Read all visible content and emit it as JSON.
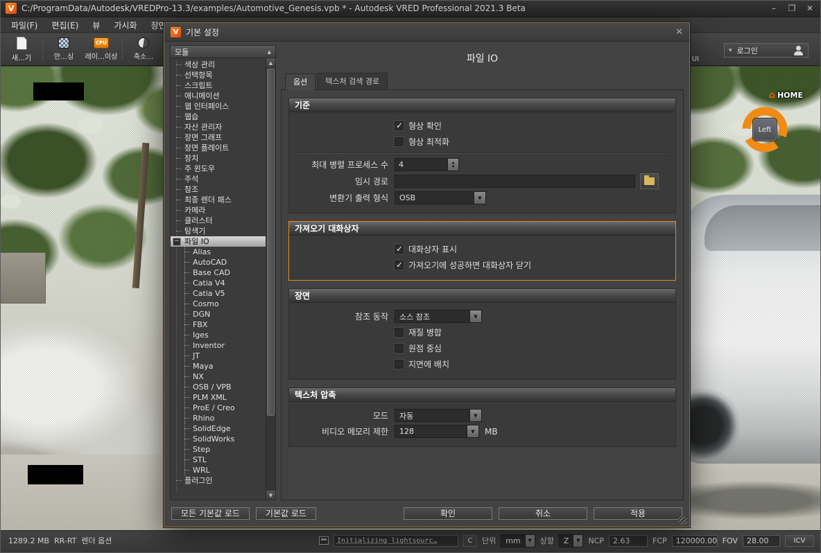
{
  "window": {
    "title": "C:/ProgramData/Autodesk/VREDPro-13.3/examples/Automotive_Genesis.vpb * - Autodesk VRED Professional 2021.3 Beta",
    "minimize": "–",
    "maximize": "❐",
    "close": "✕"
  },
  "menubar": {
    "items": [
      {
        "label": "파일(F)"
      },
      {
        "label": "편집(E)"
      },
      {
        "label": "뷰"
      },
      {
        "label": "가시화"
      },
      {
        "label": "장면"
      }
    ]
  },
  "toolbar": {
    "items": [
      {
        "label": "새…기",
        "icon": "new-file-icon"
      },
      {
        "label": "안…싱",
        "icon": "antialiasing-icon"
      },
      {
        "label": "레이…이상",
        "icon": "cpu-icon"
      },
      {
        "label": "축소…",
        "icon": "halfsphere-icon"
      }
    ],
    "ui_label": "UI",
    "login_label": "로그인"
  },
  "viewport": {
    "navcube": {
      "home": "HOME",
      "face": "Left"
    }
  },
  "dialog": {
    "title": "기본 설정",
    "close": "✕",
    "modules_header": "모듈",
    "page_title": "파일 IO",
    "tabs": [
      {
        "label": "옵션",
        "active": true
      },
      {
        "label": "텍스처 검색 경로",
        "active": false
      }
    ],
    "tree": {
      "items": [
        {
          "label": "색상 관리",
          "level": 0
        },
        {
          "label": "선택항목",
          "level": 0
        },
        {
          "label": "스크립트",
          "level": 0
        },
        {
          "label": "애니메이션",
          "level": 0
        },
        {
          "label": "웹 인터페이스",
          "level": 0
        },
        {
          "label": "웹습",
          "level": 0
        },
        {
          "label": "자산 관리자",
          "level": 0
        },
        {
          "label": "장면 그래프",
          "level": 0
        },
        {
          "label": "장면 플레이트",
          "level": 0
        },
        {
          "label": "장치",
          "level": 0
        },
        {
          "label": "주 윈도우",
          "level": 0
        },
        {
          "label": "주석",
          "level": 0
        },
        {
          "label": "참조",
          "level": 0
        },
        {
          "label": "최종 렌더 패스",
          "level": 0
        },
        {
          "label": "카메라",
          "level": 0
        },
        {
          "label": "클러스터",
          "level": 0
        },
        {
          "label": "탐색기",
          "level": 0
        },
        {
          "label": "파일 IO",
          "level": 0,
          "selected": true,
          "expander": true
        },
        {
          "label": "Alias",
          "level": 1
        },
        {
          "label": "AutoCAD",
          "level": 1
        },
        {
          "label": "Base CAD",
          "level": 1
        },
        {
          "label": "Catia V4",
          "level": 1
        },
        {
          "label": "Catia V5",
          "level": 1
        },
        {
          "label": "Cosmo",
          "level": 1
        },
        {
          "label": "DGN",
          "level": 1
        },
        {
          "label": "FBX",
          "level": 1
        },
        {
          "label": "Iges",
          "level": 1
        },
        {
          "label": "Inventor",
          "level": 1
        },
        {
          "label": "JT",
          "level": 1
        },
        {
          "label": "Maya",
          "level": 1
        },
        {
          "label": "NX",
          "level": 1
        },
        {
          "label": "OSB / VPB",
          "level": 1
        },
        {
          "label": "PLM XML",
          "level": 1
        },
        {
          "label": "ProE / Creo",
          "level": 1
        },
        {
          "label": "Rhino",
          "level": 1
        },
        {
          "label": "SolidEdge",
          "level": 1
        },
        {
          "label": "SolidWorks",
          "level": 1
        },
        {
          "label": "Step",
          "level": 1
        },
        {
          "label": "STL",
          "level": 1
        },
        {
          "label": "WRL",
          "level": 1
        },
        {
          "label": "플러그인",
          "level": 0
        }
      ]
    },
    "standard": {
      "title": "기준",
      "geometry_check": {
        "label": "형상 확인",
        "checked": true
      },
      "geometry_optimize": {
        "label": "형상 최적화",
        "checked": false
      },
      "max_parallel": {
        "label": "최대 병렬 프로세스 수",
        "value": "4"
      },
      "temp_path": {
        "label": "임시 경로",
        "value": ""
      },
      "converter_format": {
        "label": "변환기 출력 형식",
        "value": "OSB"
      }
    },
    "import_dialog": {
      "title": "가져오기 대화상자",
      "show_dialog": {
        "label": "대화상자 표시",
        "checked": true
      },
      "close_on_success": {
        "label": "가져오기에 성공하면 대화상자 닫기",
        "checked": true
      }
    },
    "scene": {
      "title": "장면",
      "reference_behavior": {
        "label": "참조 동작",
        "value": "소스 참조"
      },
      "merge_materials": {
        "label": "재질 병합",
        "checked": false
      },
      "center_origin": {
        "label": "원점 중심",
        "checked": false
      },
      "place_on_ground": {
        "label": "지면에 배치",
        "checked": false
      }
    },
    "texture": {
      "title": "텍스처 압축",
      "mode": {
        "label": "모드",
        "value": "자동"
      },
      "video_memory": {
        "label": "비디오 메모리 제한",
        "value": "128",
        "suffix": "MB"
      }
    },
    "footer": {
      "load_all_defaults": "모든 기본값 로드",
      "load_defaults": "기본값 로드",
      "ok": "확인",
      "cancel": "취소",
      "apply": "적용"
    }
  },
  "statusbar": {
    "memory": "1289.2 MB",
    "mode": "RR-RT",
    "render_options": "렌더 옵션",
    "progress": "Initializing lightsourc…",
    "c_button": "C",
    "unit_label": "단위",
    "unit_value": "mm",
    "up_label": "상향",
    "up_value": "Z",
    "ncp_label": "NCP",
    "ncp_value": "2.63",
    "fcp_label": "FCP",
    "fcp_value": "120000.00",
    "fov_label": "FOV",
    "fov_value": "28.00",
    "icv_label": "ICV"
  }
}
